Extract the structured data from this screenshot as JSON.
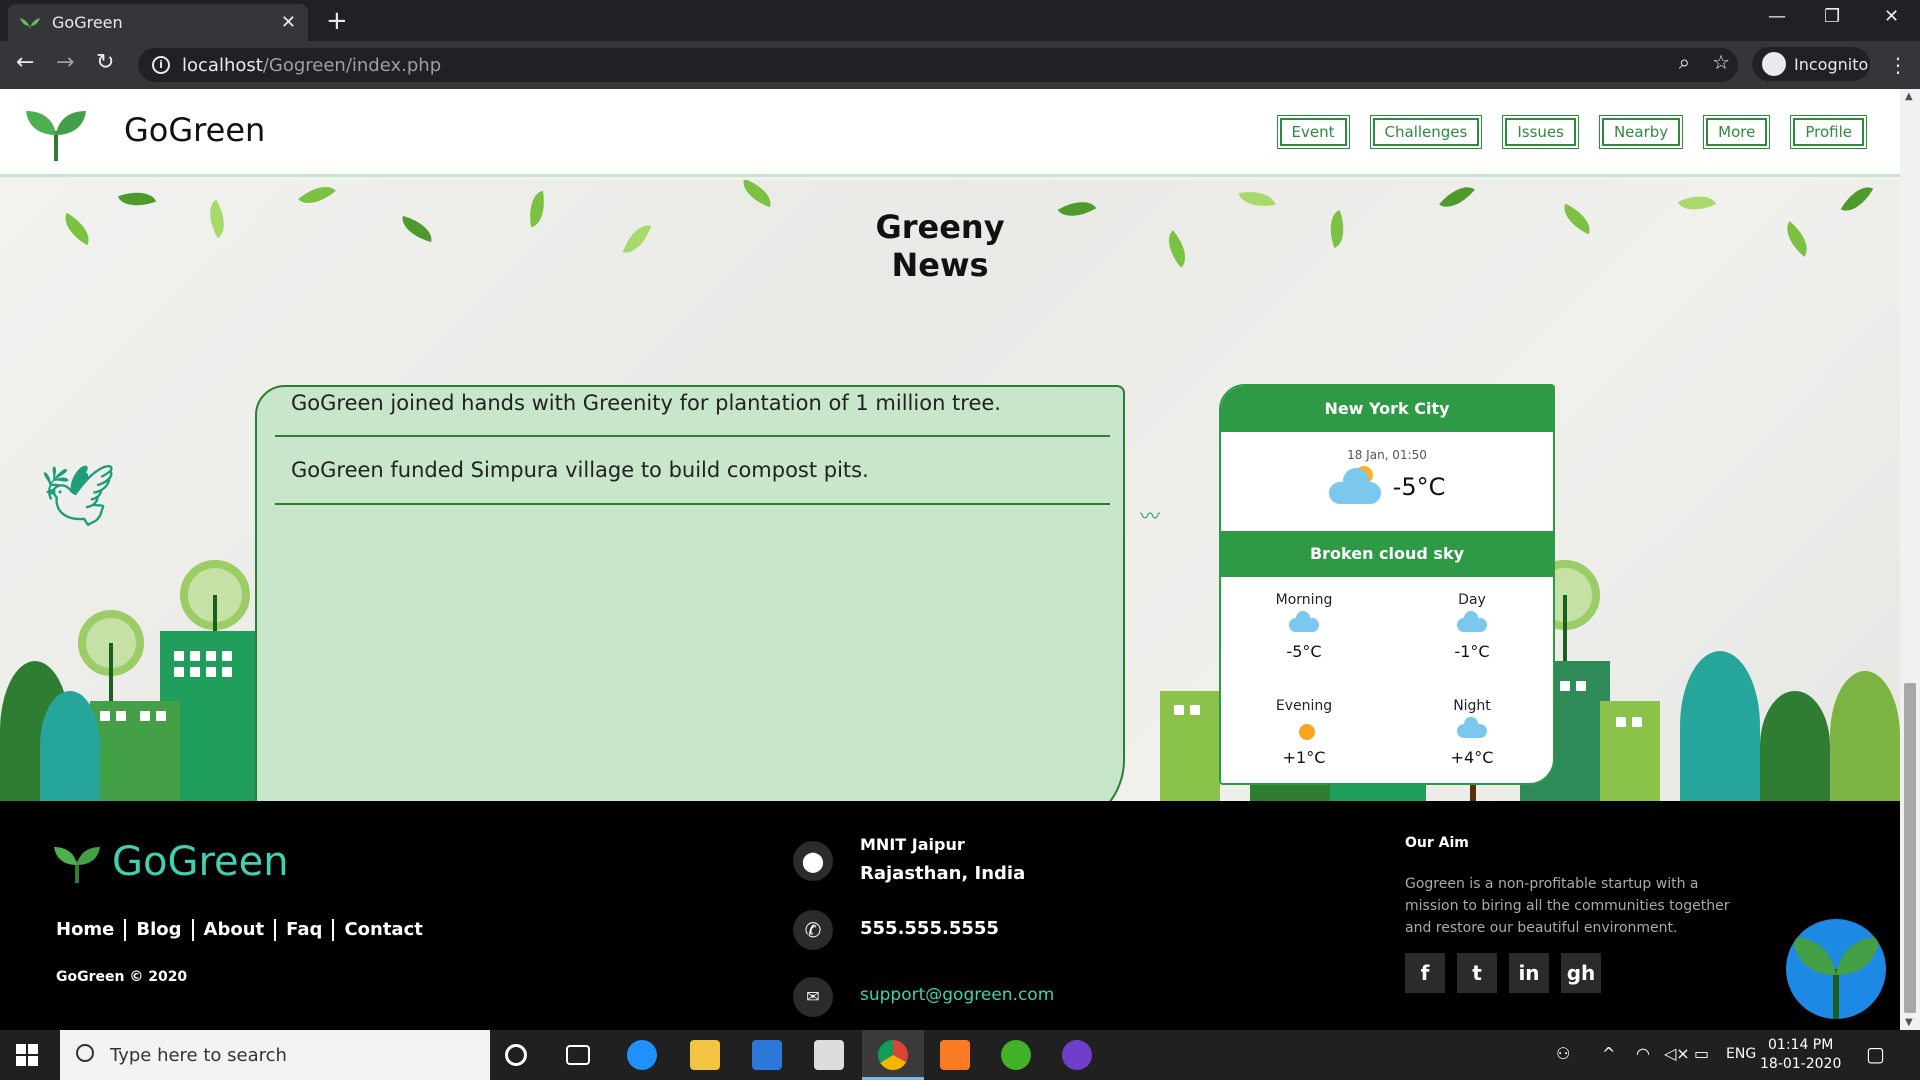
{
  "browser": {
    "tab_title": "GoGreen",
    "tab_close": "✕",
    "new_tab": "+",
    "url_host": "localhost",
    "url_path": "/Gogreen/index.php",
    "incognito_label": "Incognito",
    "window_controls": [
      "—",
      "❐",
      "✕"
    ]
  },
  "site": {
    "brand": "GoGreen",
    "nav": [
      "Event",
      "Challenges",
      "Issues",
      "Nearby",
      "More",
      "Profile"
    ]
  },
  "news": {
    "title": "Greeny News",
    "items": [
      "GoGreen joined hands with Greenity for plantation of 1 million tree.",
      "GoGreen funded Simpura village to build compost pits."
    ]
  },
  "weather": {
    "city": "New York City",
    "date": "18 Jan, 01:50",
    "current_temp": "-5°C",
    "description": "Broken cloud sky",
    "slots": [
      {
        "label": "Morning",
        "temp": "-5°C",
        "icon": "cloud-icon"
      },
      {
        "label": "Day",
        "temp": "-1°C",
        "icon": "cloud-icon"
      },
      {
        "label": "Evening",
        "temp": "+1°C",
        "icon": "moon-rain-icon"
      },
      {
        "label": "Night",
        "temp": "+4°C",
        "icon": "cloud-icon"
      }
    ]
  },
  "footer": {
    "brand": "GoGreen",
    "links": [
      "Home",
      "Blog",
      "About",
      "Faq",
      "Contact"
    ],
    "copyright": "GoGreen © 2020",
    "address_line1": "MNIT Jaipur",
    "address_line2": "Rajasthan, India",
    "phone": "555.555.5555",
    "email": "support@gogreen.com",
    "aim_title": "Our Aim",
    "aim_text": "Gogreen is a non-profitable startup with a mission to biring all the communities together and restore our beautiful environment.",
    "socials": [
      "f",
      "t",
      "in",
      "gh"
    ]
  },
  "taskbar": {
    "search_placeholder": "Type here to search",
    "language": "ENG",
    "time": "01:14 PM",
    "date": "18-01-2020"
  },
  "colors": {
    "brand_green": "#2e8b3e",
    "accent_teal": "#3fd1b3",
    "news_bg": "#c8e6c9",
    "weather_green": "#2e9a46"
  }
}
